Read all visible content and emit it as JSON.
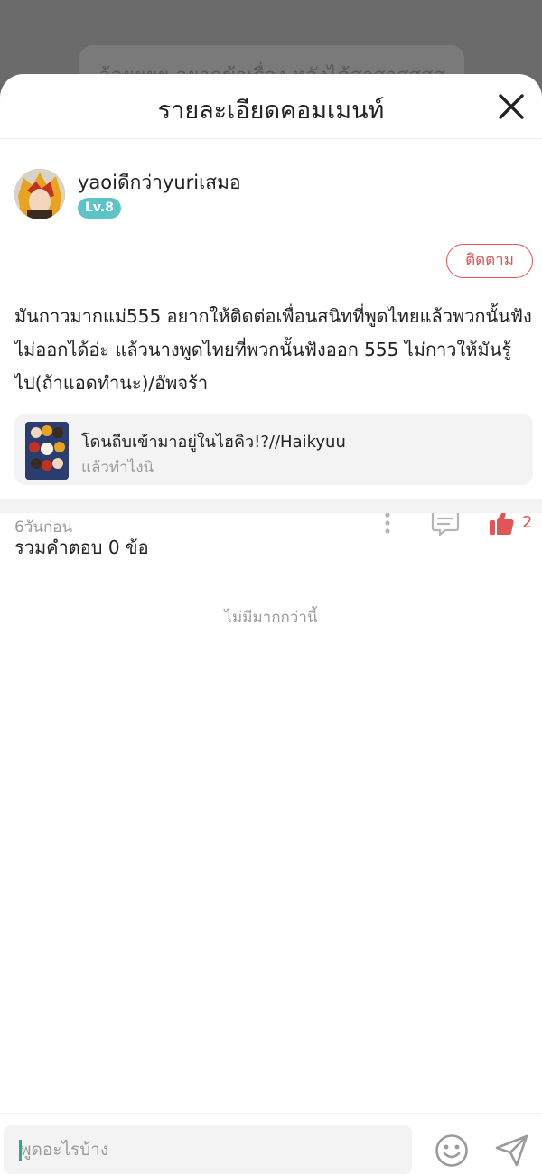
{
  "backdrop": {
    "text": "ว้อยยยย อยากข้าเรื่อง หลังได้สาสาสสสส"
  },
  "header": {
    "title": "รายละเอียดคอมเมนท์",
    "close_icon": "close-icon"
  },
  "comment": {
    "username": "yaoiดีกว่าyuriเสมอ",
    "level": "Lv.8",
    "follow_label": "ติดตาม",
    "body": "มันกาวมากแม่555 อยากให้ติดต่อเพื่อนสนิทที่พูดไทยแล้วพวกนั้นฟังไม่ออกได้อ่ะ แล้วนางพูดไทยที่พวกนั้นฟังออก 555 ไม่กาวให้มันรู้ไป(ถ้าแอดทำนะ)/อัพจร้า",
    "quote": {
      "title": "โดนถีบเข้ามาอยู่ในไฮคิว!?//Haikyuu",
      "subtitle": "แล้วทำไงนิ"
    },
    "timestamp": "6วันก่อน",
    "like_count": "2"
  },
  "replies": {
    "title": "รวมคำตอบ 0 ข้อ",
    "empty_text": "ไม่มีมากกว่านี้"
  },
  "composer": {
    "placeholder": "พูดอะไรบ้าง",
    "emoji_icon": "smiley-icon",
    "send_icon": "send-icon"
  },
  "colors": {
    "accent_red": "#e05555",
    "level_badge": "#5cc4c8",
    "caret": "#2aa89a",
    "muted_text": "#9a9a9a"
  }
}
